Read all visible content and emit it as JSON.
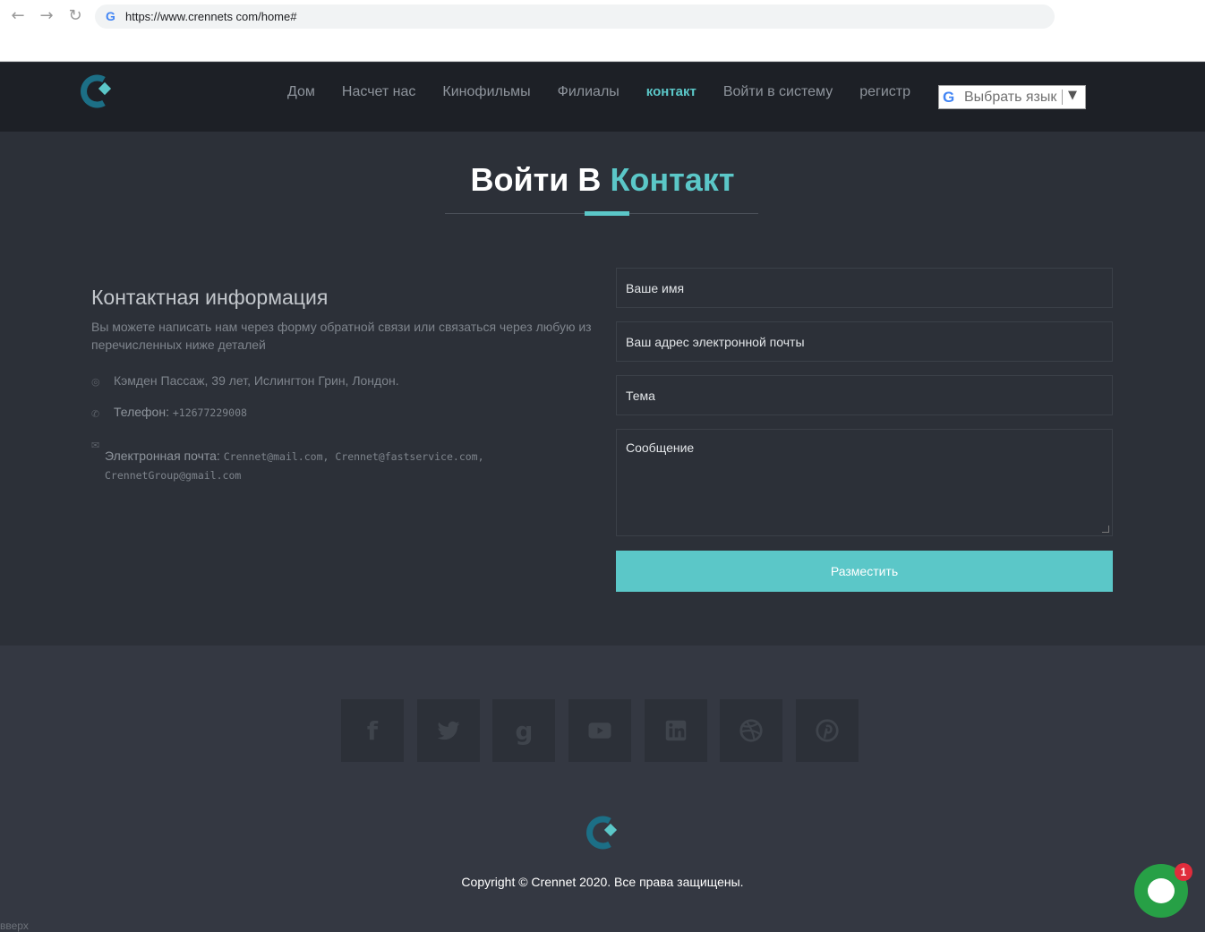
{
  "browser": {
    "url": "https://www.crennets com/home#",
    "back_icon": "arrow-left-icon",
    "forward_icon": "arrow-right-icon",
    "reload_icon": "reload-icon"
  },
  "header": {
    "nav": [
      "Дом",
      "Насчет нас",
      "Кинофильмы",
      "Филиалы",
      "контакт",
      "Войти в систему",
      "регистр"
    ],
    "active_nav": "контакт",
    "language_select": "Выбрать язык"
  },
  "contact": {
    "title_main": "Войти В",
    "title_accent": "Контакт",
    "info_title": "Контактная информация",
    "info_description": "Вы можете написать нам через форму обратной связи или связаться через любую из перечисленных ниже деталей",
    "address": "Кэмден Пассаж, 39 лет, Ислингтон Грин, Лондон.",
    "phone_label": "Телефон:",
    "phone_value": "+12677229008",
    "email_label": "Электронная почта:",
    "email_value": "Crennet@mail.com, Crennet@fastservice.com, CrennetGroup@gmail.com"
  },
  "form": {
    "name_placeholder": "Ваше имя",
    "email_placeholder": "Ваш адрес электронной почты",
    "subject_placeholder": "Тема",
    "message_placeholder": "Сообщение",
    "submit_label": "Разместить"
  },
  "footer": {
    "social": [
      "facebook-icon",
      "twitter-icon",
      "google-plus-icon",
      "youtube-icon",
      "linkedin-icon",
      "dribbble-icon",
      "pinterest-icon"
    ],
    "copyright": "Copyright © Crennet 2020. Все права защищены.",
    "back_to_top": "вверх"
  },
  "chat": {
    "badge_count": "1"
  },
  "colors": {
    "accent": "#5bc7c8",
    "header_bg": "#1d2026",
    "section_bg": "#2c3038",
    "footer_bg": "#343842",
    "chat_green": "#27a046"
  }
}
